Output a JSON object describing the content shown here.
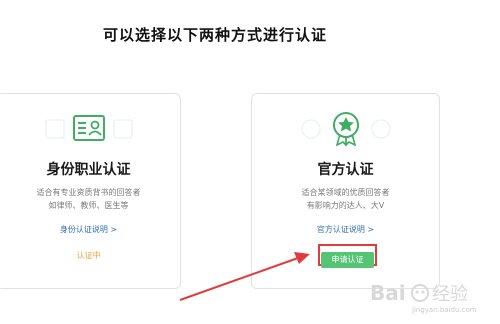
{
  "page": {
    "title": "可以选择以下两种方式进行认证"
  },
  "cards": {
    "identity": {
      "icon": "id-card-icon",
      "title": "身份职业认证",
      "desc_line1": "适合有专业资质背书的回答者",
      "desc_line2": "如律师、教师、医生等",
      "link": "身份认证说明 >",
      "status": "认证中"
    },
    "official": {
      "icon": "rosette-badge-icon",
      "title": "官方认证",
      "desc_line1": "适合某领域的优质回答者",
      "desc_line2": "有影响力的达人、大V",
      "link": "官方认证说明 >",
      "apply_button": "申请认证"
    }
  },
  "watermark": {
    "text": "Baidu 经验",
    "url_text": "jingyan.baidu.com"
  },
  "colors": {
    "accent_green": "#55c475",
    "link_blue": "#2b6fb6",
    "status_orange": "#f0a039",
    "annotation_red": "#e23b3b"
  }
}
